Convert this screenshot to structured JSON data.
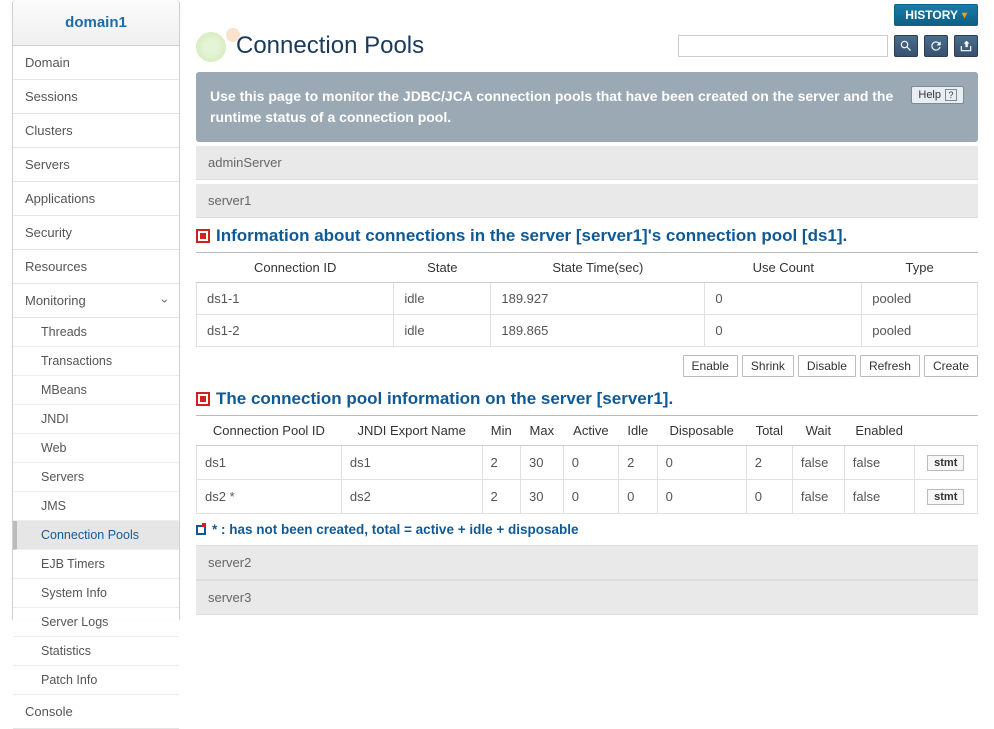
{
  "sidebar": {
    "title": "domain1",
    "items": [
      "Domain",
      "Sessions",
      "Clusters",
      "Servers",
      "Applications",
      "Security",
      "Resources"
    ],
    "monitoring_label": "Monitoring",
    "monitoring_items": [
      "Threads",
      "Transactions",
      "MBeans",
      "JNDI",
      "Web",
      "Servers",
      "JMS",
      "Connection Pools",
      "EJB Timers",
      "System Info",
      "Server Logs",
      "Statistics",
      "Patch Info"
    ],
    "console_label": "Console"
  },
  "header": {
    "history_label": "HISTORY",
    "page_title": "Connection Pools",
    "search_placeholder": ""
  },
  "banner": {
    "text": "Use this page to monitor the JDBC/JCA connection pools that have been created on the server and the runtime status of a connection pool.",
    "help_label": "Help"
  },
  "server_admin": "adminServer",
  "server_current": "server1",
  "section1": {
    "title": "Information about connections in the server [server1]'s connection pool [ds1].",
    "columns": [
      "Connection ID",
      "State",
      "State Time(sec)",
      "Use Count",
      "Type"
    ],
    "rows": [
      {
        "id": "ds1-1",
        "state": "idle",
        "time": "189.927",
        "use": "0",
        "type": "pooled"
      },
      {
        "id": "ds1-2",
        "state": "idle",
        "time": "189.865",
        "use": "0",
        "type": "pooled"
      }
    ]
  },
  "actions": {
    "enable": "Enable",
    "shrink": "Shrink",
    "disable": "Disable",
    "refresh": "Refresh",
    "create": "Create"
  },
  "section2": {
    "title": "The connection pool information on the server [server1].",
    "columns": [
      "Connection Pool ID",
      "JNDI Export Name",
      "Min",
      "Max",
      "Active",
      "Idle",
      "Disposable",
      "Total",
      "Wait",
      "Enabled",
      ""
    ],
    "rows": [
      {
        "id": "ds1",
        "jndi": "ds1",
        "min": "2",
        "max": "30",
        "active": "0",
        "idle": "2",
        "disp": "0",
        "total": "2",
        "wait": "false",
        "enabled": "false",
        "stmt": "stmt"
      },
      {
        "id": "ds2 *",
        "jndi": "ds2",
        "min": "2",
        "max": "30",
        "active": "0",
        "idle": "0",
        "disp": "0",
        "total": "0",
        "wait": "false",
        "enabled": "false",
        "stmt": "stmt"
      }
    ]
  },
  "footnote": "* : has not been created, total = active + idle + disposable",
  "servers_rest": [
    "server2",
    "server3"
  ]
}
